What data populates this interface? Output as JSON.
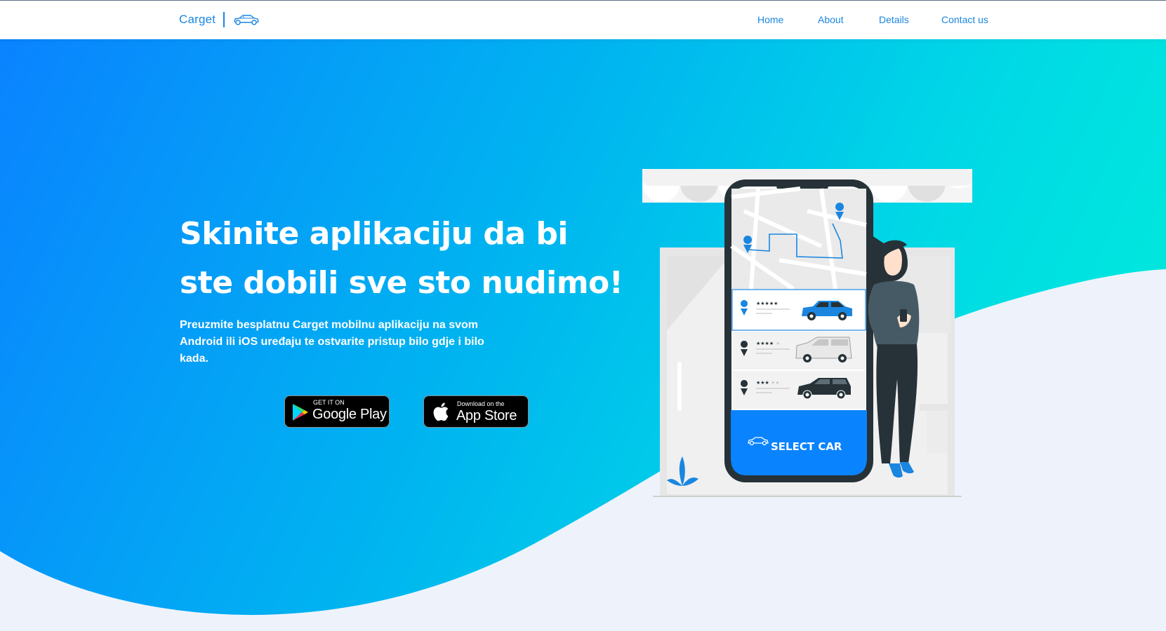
{
  "navbar": {
    "brand": "Carget",
    "links": [
      {
        "id": "home",
        "label": "Home"
      },
      {
        "id": "about",
        "label": "About"
      },
      {
        "id": "details",
        "label": "Details"
      },
      {
        "id": "contact",
        "label": "Contact us"
      }
    ],
    "brand_icon": "car-outline-icon"
  },
  "hero": {
    "headline": "Skinite aplikaciju da bi ste dobili sve sto nudimo!",
    "subtext": "Preuzmite besplatnu Carget mobilnu aplikaciju na svom Android ili iOS uređaju te ostvarite pristup bilo gdje i bilo kada.",
    "google_play": {
      "small": "GET IT ON",
      "big": "Google Play"
    },
    "app_store": {
      "small": "Download on the",
      "big": "App Store"
    }
  },
  "illustration": {
    "select_car_label": "SELECT CAR",
    "car_options": [
      {
        "rating": 5,
        "color": "#1a86e0"
      },
      {
        "rating": 4,
        "color": "#e6e6e6"
      },
      {
        "rating": 3,
        "color": "#263238"
      }
    ]
  },
  "colors": {
    "accent": "#1a86e0",
    "gradient_start": "#0a83ff",
    "gradient_end": "#00f0d8",
    "wave": "#eef3fb"
  }
}
